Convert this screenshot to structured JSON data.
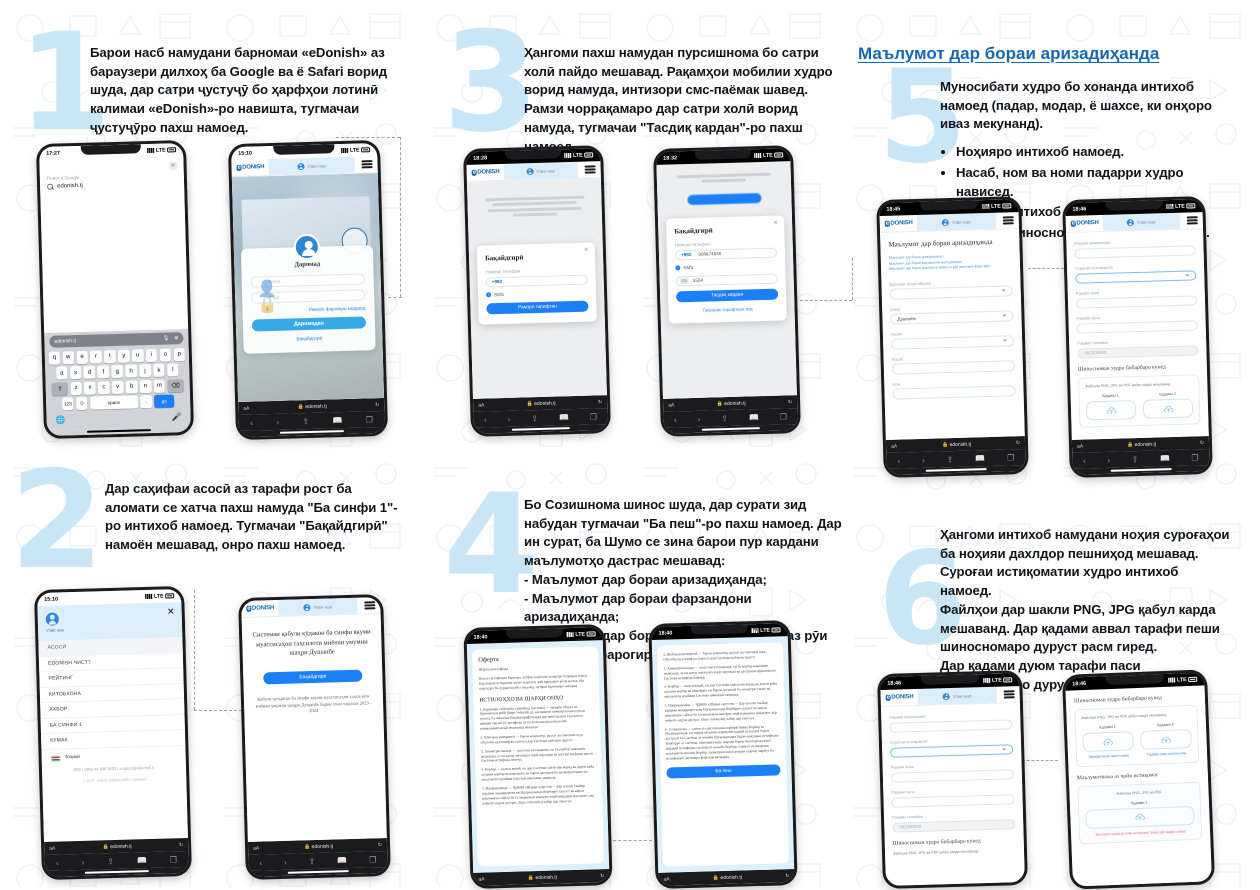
{
  "steps": [
    {
      "number": "1",
      "text": "Барои насб намудани барномаи «eDonish» аз бараузери дилхоҳ ба Google ва ё Safari ворид шуда, дар сатри ҷустуҷӯ бо ҳарфҳои лотинӣ калимаи «eDonish»-ро навишта, тугмачаи ҷустуҷӯро пахш намоед."
    },
    {
      "number": "2",
      "text": "Дар саҳифаи асосӣ аз тарафи рост ба аломати се хатча пахш намуда \"Ба синфи 1\"-ро интихоб намоед. Тугмачаи \"Бақайдгирӣ\" намоён мешавад, онро пахш намоед."
    },
    {
      "number": "3",
      "text": "Ҳангоми пахш намудан пурсишнома бо сатри холӣ пайдо мешавад. Рақамҳои мобилии худро ворид намуда, интизори смс-паёмак шавед. Рамзи чоррақамаро дар сатри холӣ ворид намуда, тугмачаи \"Тасдиқ кардан\"-ро пахш намоед."
    },
    {
      "number": "4",
      "text": "Бо Созишнома шинос шуда, дар сурати зид набудан тугмачаи \"Ба пеш\"-ро пахш намоед. Дар ин сурат, ба Шумо се зина барои пур кардани маълумотҳо дастрас мешавад:\n- Маълумот дар бораи аризадиҳанда;\n- Маълумот дар бораи фарзандони аризадиҳанда;\n- Маълумот дар бораи мактабҳои миёна аз рӯи минатақаи фарогирӣ."
    },
    {
      "number": "5",
      "text": "Муносибати худро бо хонанда интихоб намоед (падар, модар, ё шахсе, ки онҳоро иваз мекунанд).",
      "bullets": [
        "Ноҳияро интихоб намоед.",
        "Насаб, ном ва номи падарри  худро нависед.",
        "Ҷинсро интихоб намоед.",
        "Рақами шиносномаи худро дарҷ кунед."
      ]
    },
    {
      "number": "6",
      "text": "Ҳангоми интихоб намудани ноҳия суроғаҳои ба ноҳияи дахлдор пешниҳод мешавад. Суроғаи истиқоматии худро интихоб намоед.\nФайлҳои дар шакли PNG, JPG қабул карда мешаванд. Дар қадами аввал тарафи пеши шиносномаро дуруст расм гиред.\nДар қадами дуюм тарафи паси шиносномаро дуруст расм гиред."
    }
  ],
  "section_title": "Маълумот дар бораи аризадиҳанда",
  "brand": {
    "logo_prefix": "e",
    "logo_text": "DONISH",
    "accent": "#1469b0",
    "button_blue": "#1b7ff5",
    "light_blue": "#ddeefb",
    "number_blue": "#c9e6f7"
  },
  "header_pill": {
    "label": "Узви нав"
  },
  "safari": {
    "aa": "аА",
    "lock": "🔒",
    "url": "edonish.tj",
    "reload": "↻"
  },
  "phones": {
    "p1_google": {
      "time": "17:27",
      "carrier": "LTE",
      "search_label": "Поиск в Google",
      "search_query": "edonish.tj",
      "kb_query": "edonish.tj",
      "keyboard_rows": [
        [
          "q",
          "w",
          "e",
          "r",
          "t",
          "y",
          "u",
          "i",
          "o",
          "p"
        ],
        [
          "a",
          "s",
          "d",
          "f",
          "g",
          "h",
          "j",
          "k",
          "l"
        ],
        [
          "z",
          "x",
          "c",
          "v",
          "b",
          "n",
          "m"
        ]
      ],
      "key_numeric": "123",
      "key_space": "space",
      "key_go": "go"
    },
    "p2_login": {
      "time": "15:10",
      "title": "Даромад",
      "field_login_placeholder": "Логин",
      "field_pass_placeholder": "Рамз",
      "forgot": "Рамзро фаромуш кардаед",
      "submit": "Даромадан",
      "register": "Бақайдгирӣ"
    },
    "p3_modal_phone": {
      "time": "18:28",
      "modal_title": "Бақайдгирӣ",
      "phone_label": "Номери телефон",
      "prefix": "+992",
      "value": "",
      "sms_option": "SMS",
      "submit": "Рамзро гирифтан"
    },
    "p4_modal_code": {
      "time": "18:32",
      "modal_title": "Бақайдгирӣ",
      "phone_label": "Номери телефон",
      "prefix": "+992",
      "value": "908874948",
      "sms_option": "SMS",
      "code_value": "5504",
      "submit": "Тасдиқ кардан",
      "link": "Такроран гирифтани код"
    },
    "p5_menu": {
      "time": "15:10",
      "user_label": "Узви нав",
      "items": [
        "АСОСӢ",
        "EDONISH ЧИСТ?",
        "РЕЙТИНГ",
        "КИТОБХОНА",
        "АХБОР",
        "БА СИНФИ 1",
        "КУМАК"
      ],
      "language": "Тоҷикӣ",
      "contacts": "903  |  +992 44 600 3002  |  support@edonish.tj",
      "copyright": "© 2024, Ҳамаи ҳуқуқҳо ҳифз шудаанд"
    },
    "p6_landing": {
      "time": "18:28",
      "headline": "Системаи қабули кӯдакон ба синфи якуми муассисаҳои таҳсилоти миёнаи умумии шаҳри Душанбе",
      "button": "Бақайдгирӣ",
      "sub": "Қабули ҳуҷҷатҳо ба синфи якуми муассисаҳои таҳсилоти миёнаи умумии шаҳри Душанбе барои соли таҳсили 2023 - 2024"
    },
    "p7_oferta": {
      "time": "18:40",
      "title": "Оферта",
      "subtitle": "Шартҳои истифода",
      "intro": "Пеш аз истифодаи барнома, лутфан шартҳои ҳозираро бодиққат хонед. Бар шароити барнома шумо шартҳои ҷойгиршударо розӣ ҳастед. Ин шартҳоро ба пуррагӣ қабул накунед, лутфан барномаро набаред.",
      "section_title": "ИСТИЛОҲҲО ВА ШАРҲИ ОНҲО",
      "items": [
        "1. Барномаи «eDonish» (минбаъд Система) — маҷмӯи обҷект ва барномаҳои вебӣ (https://edonish.tj), ки имкони хизматрасониҳо роҳи кушод, ба шахсони бақайдгирифташуда дар минтақаҳои таҳсилоти миёнаи умумӣ бо истифода аз технологияҳои иттилоотӣ-коммуникатсионӣ пешниҳод мекунад.",
        "2. Шабакаи интернетӣ — барои компютер, рухсат ва тамошои шуд. Обутоби мухталиф ва таносул дар Системи шабакаи ҷудост.",
        "3. Хизматрасонанда — шахсони алоҳидаанд, ки ба корбар имконият медиҳанд, аз он қатор амалҳоро чорӣ гиронида ва дастрасии функсияҳои Системи истифода намояд.",
        "4. Корбар — шахси воқеӣ, ки дар Системи сайти нав ворид ва дорои қайд шудани корбар ва имконият, ки барои дастрасӣ ба хизматрасониҳо ва маълумоти муайяни Система имконият медиҳад.",
        "5. Идоракунанда — ҶДММ «Шарқи хуросон» – Дар ҳолати таъйир кардани муқаррароти ин Идоракунанда Корбарро хушаст ва нархи имконияти сайтҳо ба Созишномаи манзури чорӣ намудани маълумот дар чойи бо кадом дастрас, https://edonish.tj чабар дар таносул.",
        "6. Созишнома — ҳаёти аз сиёсатномаи корбарӣ байни Корбар ва Идоракунанда, ки шарти моҳияти иҷрокунӣ ҳудудӣ ва муҳим барои дастрасӣ ба Система аз чониби Идоракунанда будан намудани истифодаи Корбарро аз система, имкондиҳанда, шароит барои бехатарӣ ва ваъб карданӣ истифодаи система аз ҷониби Корбар, содирот пешдароми маълумоти шахсии Корбар, хизматрасониҳо доираи шароит марбут ба истифодаи Системаро фароҳам меоварад."
      ],
      "button": "Ба пеш"
    },
    "p8_oferta2": {
      "time": "18:40"
    },
    "p9_form": {
      "time": "18:45",
      "title": "Маълумот дар бораи аризадиҳанда",
      "breadcrumbs": "Маълумот дар бораи аризадиҳанда  /\nМаълумот дар бораи фарзандони аризадиҳанда  /\nМаълумот дар бораи мактабҳои миёна аз рӯи минтақаи фарогирӣ",
      "fields": [
        {
          "label": "Дараҷаи хешутабории",
          "value": "",
          "type": "select"
        },
        {
          "label": "Шаҳр",
          "value": "Душанбе",
          "type": "select"
        },
        {
          "label": "Ноҳия",
          "value": "",
          "type": "select"
        },
        {
          "label": "Насаб",
          "value": "",
          "type": "text"
        },
        {
          "label": "Ном",
          "value": "",
          "type": "text"
        }
      ]
    },
    "p10_form2": {
      "time": "18:46",
      "fields": [
        {
          "label": "Рақами шиноснома",
          "value": "",
          "type": "text"
        },
        {
          "label": "Суроғаи истиқоматӣ",
          "value": "",
          "type": "select"
        },
        {
          "label": "Рақами хона",
          "value": "",
          "type": "text"
        },
        {
          "label": "Рақами хона",
          "value": "",
          "type": "text"
        },
        {
          "label": "Рақами телефон",
          "value": "992000000",
          "type": "filled"
        }
      ],
      "upload_title": "Шиносномаи худро бибарбаро кунед",
      "upload_note": "Файлҳои PNG, JPG ва PDF қабул карда мешаванд.",
      "step1": "Қадами 1",
      "step2": "Қадами 2",
      "step1_link": "Тарафи пеши шиноснома",
      "step2_link": "Тарафи паси шиноснома"
    },
    "p11_upload": {
      "time": "18:46",
      "upload_title": "Шиносномаи худро бибарбаро кунед",
      "upload_note": "Файлҳои PNG, JPG ва PDF қабул карда мешаванд.",
      "step1": "Қадами 1",
      "step2": "Қадами 2",
      "step1_link": "Тарафи пеши шиноснома",
      "step2_link": "Тарафи паси шиноснома",
      "second_title": "Маълумотнома аз ҷойи истиқомат",
      "second_note": "Файлҳои PNG, JPG ва PDF",
      "second_cap": "Қадами 1",
      "second_err": "Маълумотнома аз ҷойи истиқомат бояд пур карда шавад"
    }
  }
}
